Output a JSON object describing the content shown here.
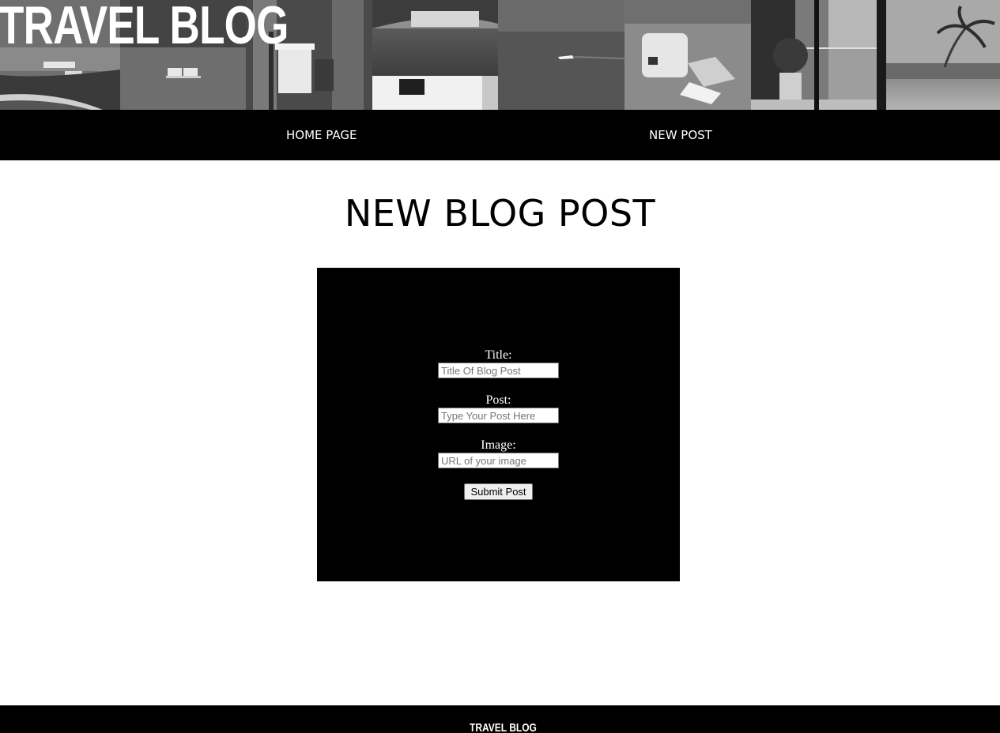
{
  "banner": {
    "title": "TRAVEL BLOG",
    "photos": [
      "coastal-harbor-yachts-photo",
      "beach-lounge-chairs-photo",
      "window-cafe-table-photo",
      "lake-villa-deck-photo",
      "ocean-speedboat-photo",
      "beach-bag-towel-photo",
      "balcony-sea-view-photo",
      "beach-palm-tree-photo"
    ]
  },
  "nav": {
    "home_label": "HOME PAGE",
    "new_post_label": "NEW POST"
  },
  "main": {
    "heading": "NEW BLOG POST"
  },
  "form": {
    "title_label": "Title:",
    "title_placeholder": "Title Of Blog Post",
    "post_label": "Post:",
    "post_placeholder": "Type Your Post Here",
    "image_label": "Image:",
    "image_placeholder": "URL of your image",
    "submit_label": "Submit Post"
  },
  "footer": {
    "logo": "TRAVEL BLOG"
  },
  "colors": {
    "nav_background": "#000000",
    "panel_background": "#000000",
    "text_on_dark": "#ffffff",
    "page_background": "#ffffff"
  }
}
